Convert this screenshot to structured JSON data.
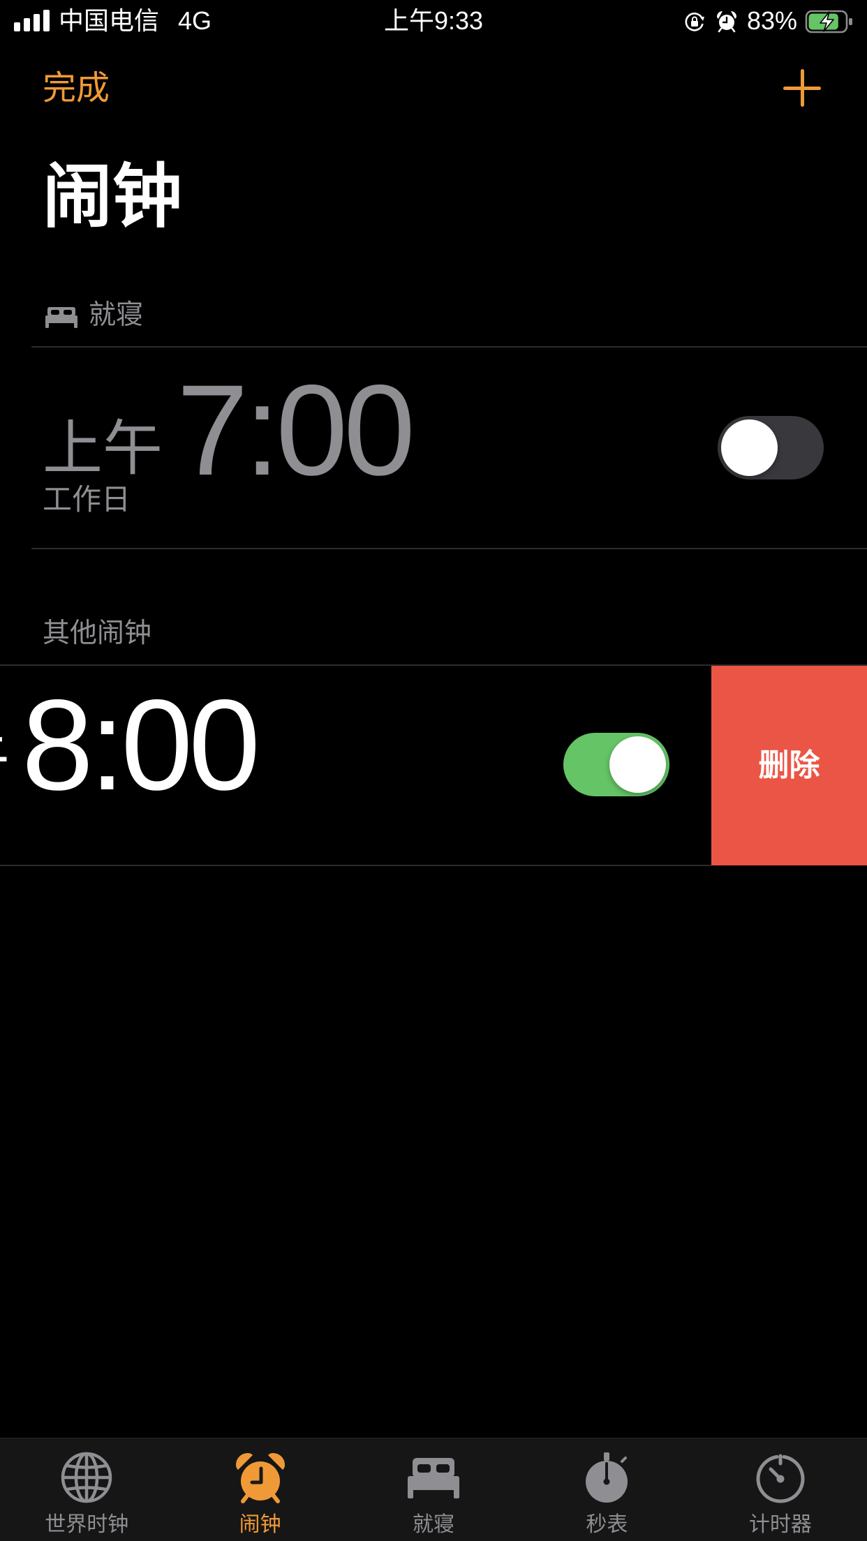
{
  "status_bar": {
    "carrier": "中国电信",
    "network": "4G",
    "time": "上午9:33",
    "battery_percent": "83%",
    "battery_level": 0.83,
    "charging": true,
    "icons": [
      "signal-icon",
      "orientation-lock-icon",
      "alarm-icon",
      "battery-icon"
    ]
  },
  "nav": {
    "done_label": "完成",
    "add_icon": "plus-icon",
    "title": "闹钟"
  },
  "sleep_section": {
    "header": "就寝",
    "icon": "bed-icon",
    "alarm": {
      "ampm": "上午",
      "time": "7:00",
      "repeat": "工作日",
      "enabled": false
    }
  },
  "other_section": {
    "header": "其他闹钟",
    "alarms": [
      {
        "ampm": "上午",
        "time": "8:00",
        "enabled": true,
        "swipe_action_label": "删除"
      }
    ]
  },
  "tab_bar": {
    "active_index": 1,
    "tabs": [
      {
        "label": "世界时钟",
        "icon": "globe-icon"
      },
      {
        "label": "闹钟",
        "icon": "alarm-clock-icon"
      },
      {
        "label": "就寝",
        "icon": "bed-icon"
      },
      {
        "label": "秒表",
        "icon": "stopwatch-icon"
      },
      {
        "label": "计时器",
        "icon": "timer-icon"
      }
    ]
  },
  "colors": {
    "background": "#000000",
    "accent": "#f09a37",
    "secondary_text": "#8e8e93",
    "delete": "#eb5545",
    "toggle_on": "#65c466",
    "toggle_off": "#39393d",
    "tab_bar": "#161616",
    "separator": "#2c2c2e"
  }
}
